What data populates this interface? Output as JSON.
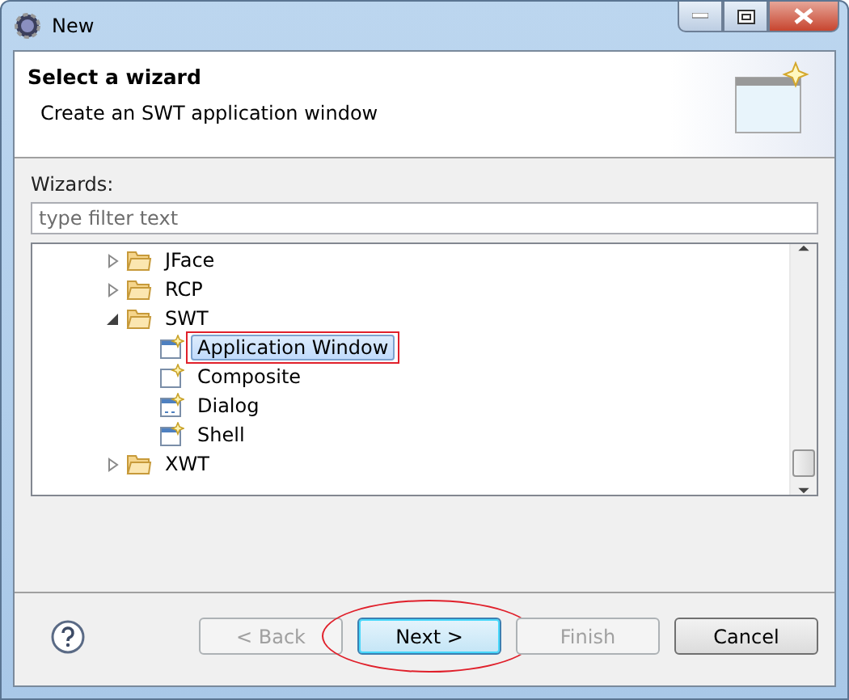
{
  "window": {
    "title": "New"
  },
  "header": {
    "title": "Select a wizard",
    "description": "Create an SWT application window"
  },
  "wizards_label": "Wizards:",
  "filter": {
    "placeholder": "type filter text"
  },
  "tree": [
    {
      "label": "JFace",
      "kind": "folder",
      "expanded": false,
      "selected": false,
      "annotated": false
    },
    {
      "label": "RCP",
      "kind": "folder",
      "expanded": false,
      "selected": false,
      "annotated": false
    },
    {
      "label": "SWT",
      "kind": "folder",
      "expanded": true,
      "selected": false,
      "annotated": false,
      "children": [
        {
          "label": "Application Window",
          "kind": "window",
          "selected": true,
          "annotated": true
        },
        {
          "label": "Composite",
          "kind": "composite",
          "selected": false,
          "annotated": false
        },
        {
          "label": "Dialog",
          "kind": "dialog",
          "selected": false,
          "annotated": false
        },
        {
          "label": "Shell",
          "kind": "window",
          "selected": false,
          "annotated": false
        }
      ]
    },
    {
      "label": "XWT",
      "kind": "folder",
      "expanded": false,
      "selected": false,
      "annotated": false
    }
  ],
  "buttons": [
    {
      "label": "< Back",
      "disabled": true,
      "default": false,
      "annotated": false
    },
    {
      "label": "Next >",
      "disabled": false,
      "default": true,
      "annotated": true
    },
    {
      "label": "Finish",
      "disabled": true,
      "default": false,
      "annotated": false
    },
    {
      "label": "Cancel",
      "disabled": false,
      "default": false,
      "annotated": false
    }
  ]
}
